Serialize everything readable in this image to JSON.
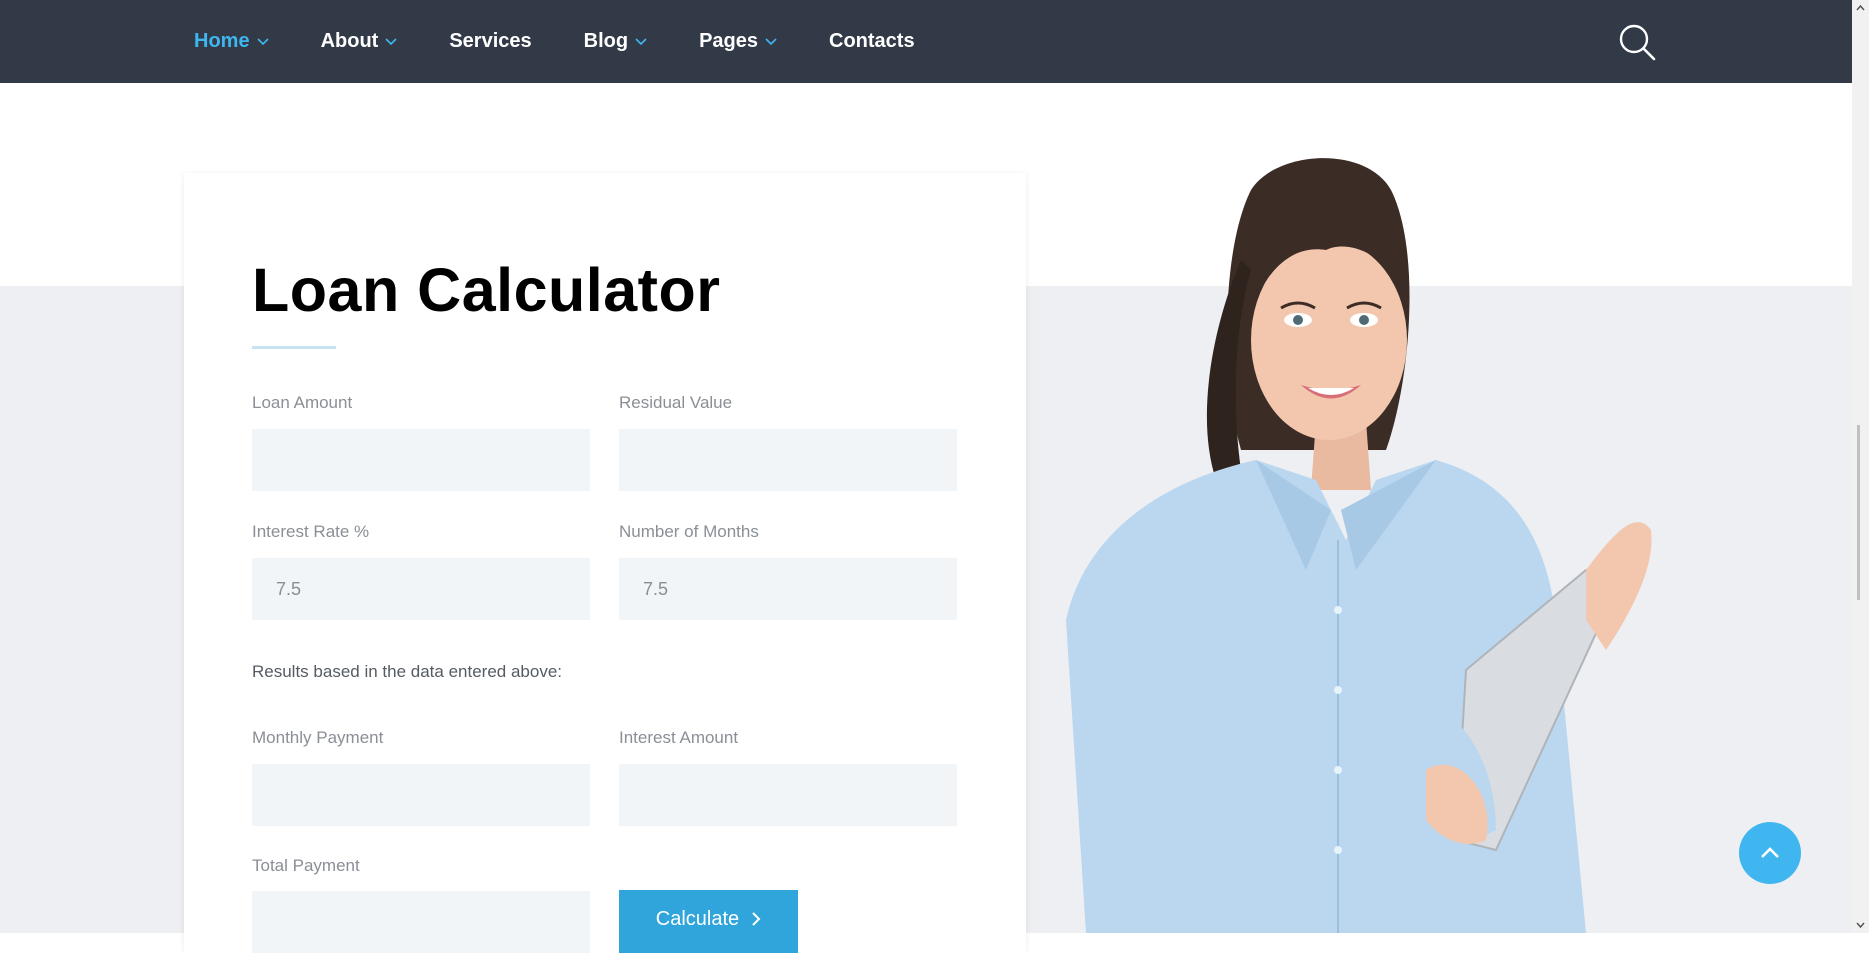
{
  "nav": {
    "items": [
      {
        "label": "Home",
        "has_dropdown": true,
        "active": true
      },
      {
        "label": "About",
        "has_dropdown": true,
        "active": false
      },
      {
        "label": "Services",
        "has_dropdown": false,
        "active": false
      },
      {
        "label": "Blog",
        "has_dropdown": true,
        "active": false
      },
      {
        "label": "Pages",
        "has_dropdown": true,
        "active": false
      },
      {
        "label": "Contacts",
        "has_dropdown": false,
        "active": false
      }
    ],
    "search_icon": "search-icon"
  },
  "calculator": {
    "title": "Loan Calculator",
    "fields": {
      "loan_amount": {
        "label": "Loan Amount",
        "value": ""
      },
      "residual_value": {
        "label": "Residual Value",
        "value": ""
      },
      "interest_rate": {
        "label": "Interest Rate %",
        "value": "7.5"
      },
      "number_of_months": {
        "label": "Number of Months",
        "value": "7.5"
      }
    },
    "results_text": "Results based in the data entered above:",
    "results": {
      "monthly_payment": {
        "label": "Monthly Payment",
        "value": ""
      },
      "interest_amount": {
        "label": "Interest Amount",
        "value": ""
      },
      "total_payment": {
        "label": "Total Payment",
        "value": ""
      }
    },
    "calculate_label": "Calculate"
  },
  "colors": {
    "nav_bg": "#323a48",
    "accent": "#3fb6ef",
    "button": "#2fa5dc",
    "input_bg": "#f2f5f8",
    "band_bg": "#eeeff2"
  },
  "back_to_top_icon": "chevron-up-icon"
}
